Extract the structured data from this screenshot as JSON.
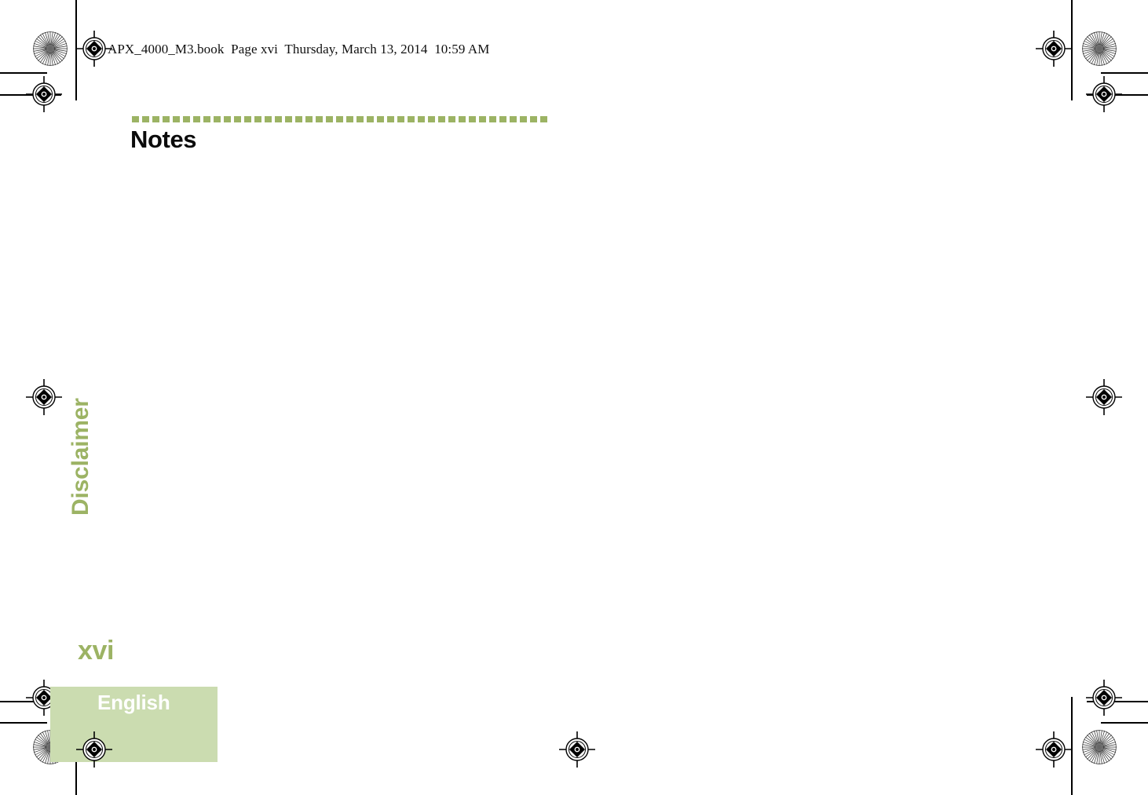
{
  "document": {
    "proof_header": "APX_4000_M3.book  Page xvi  Thursday, March 13, 2014  10:59 AM",
    "source_file": "APX_4000_M3.book",
    "page_label": "Page xvi",
    "timestamp": "Thursday, March 13, 2014  10:59 AM"
  },
  "content": {
    "section_title": "Notes",
    "side_tab": "Disclaimer",
    "folio": "xvi",
    "language": "English"
  },
  "colors": {
    "accent_green": "#9cb364",
    "band_green": "#cbdcb0",
    "heading_black": "#0b0b0b",
    "language_label": "#ffffff",
    "page_background": "#ffffff"
  },
  "marks": {
    "registration_target": "registration-target-icon",
    "starburst": "star-target-icon",
    "trim_line": "trim-line"
  }
}
